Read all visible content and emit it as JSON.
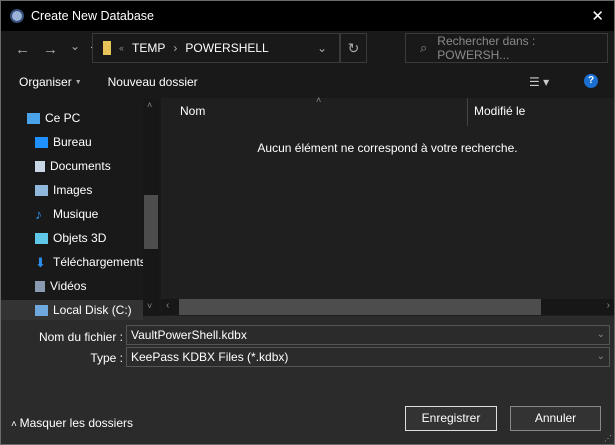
{
  "window": {
    "title": "Create New Database",
    "close": "✕"
  },
  "address": {
    "back": "←",
    "forward": "→",
    "recent": "⌄",
    "up": "↑",
    "overflow": "«",
    "path": [
      "TEMP",
      "POWERSHELL"
    ],
    "separator": "›",
    "dropdown": "⌄",
    "refresh": "↻",
    "search_placeholder": "Rechercher dans : POWERSH..."
  },
  "toolbar": {
    "organise": "Organiser",
    "new_folder": "Nouveau dossier",
    "help": "?"
  },
  "sidebar": {
    "items": [
      {
        "label": "Ce PC",
        "color": "#4aa3e8"
      },
      {
        "label": "Bureau",
        "color": "#1e90ff"
      },
      {
        "label": "Documents",
        "color": "#c9d6e6"
      },
      {
        "label": "Images",
        "color": "#8fb8dc"
      },
      {
        "label": "Musique",
        "color": "#2a8ee8"
      },
      {
        "label": "Objets 3D",
        "color": "#5fc8e8"
      },
      {
        "label": "Téléchargements",
        "color": "#2a8ee8"
      },
      {
        "label": "Vidéos",
        "color": "#8a9ab0"
      },
      {
        "label": "Local Disk (C:)",
        "color": "#6fa8dc"
      }
    ]
  },
  "content": {
    "col_name": "Nom",
    "col_modified": "Modifié le",
    "empty": "Aucun élément ne correspond à votre recherche."
  },
  "form": {
    "filename_label": "Nom du fichier :",
    "filename": "VaultPowerShell.kdbx",
    "type_label": "Type :",
    "type": "KeePass KDBX Files (*.kdbx)"
  },
  "footer": {
    "hide_folders": "Masquer les dossiers",
    "save": "Enregistrer",
    "cancel": "Annuler"
  }
}
